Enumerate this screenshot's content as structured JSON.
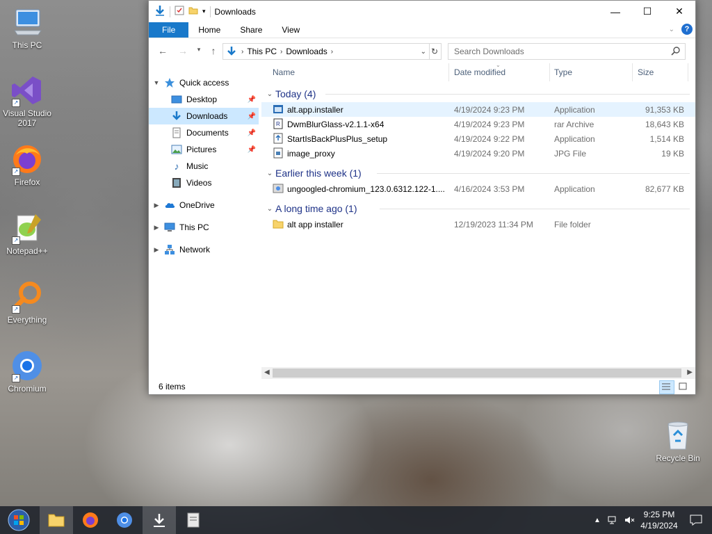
{
  "desktop": {
    "icons": [
      {
        "label": "This PC"
      },
      {
        "label": "Visual Studio 2017"
      },
      {
        "label": "Firefox"
      },
      {
        "label": "Notepad++"
      },
      {
        "label": "Everything"
      },
      {
        "label": "Chromium"
      },
      {
        "label": "Recycle Bin"
      }
    ]
  },
  "window": {
    "title": "Downloads",
    "ribbon_tabs": [
      "File",
      "Home",
      "Share",
      "View"
    ],
    "help": "?",
    "breadcrumb": [
      "This PC",
      "Downloads"
    ],
    "search_placeholder": "Search Downloads",
    "nav": {
      "quick_access": "Quick access",
      "items": [
        "Desktop",
        "Downloads",
        "Documents",
        "Pictures",
        "Music",
        "Videos"
      ],
      "onedrive": "OneDrive",
      "this_pc": "This PC",
      "network": "Network"
    },
    "columns": [
      "Name",
      "Date modified",
      "Type",
      "Size"
    ],
    "groups": [
      {
        "title": "Today (4)",
        "files": [
          {
            "name": "alt.app.installer",
            "date": "4/19/2024 9:23 PM",
            "type": "Application",
            "size": "91,353 KB"
          },
          {
            "name": "DwmBlurGlass-v2.1.1-x64",
            "date": "4/19/2024 9:23 PM",
            "type": "rar Archive",
            "size": "18,643 KB"
          },
          {
            "name": "StartIsBackPlusPlus_setup",
            "date": "4/19/2024 9:22 PM",
            "type": "Application",
            "size": "1,514 KB"
          },
          {
            "name": "image_proxy",
            "date": "4/19/2024 9:20 PM",
            "type": "JPG File",
            "size": "19 KB"
          }
        ]
      },
      {
        "title": "Earlier this week (1)",
        "files": [
          {
            "name": "ungoogled-chromium_123.0.6312.122-1....",
            "date": "4/16/2024 3:53 PM",
            "type": "Application",
            "size": "82,677 KB"
          }
        ]
      },
      {
        "title": "A long time ago (1)",
        "files": [
          {
            "name": "alt app installer",
            "date": "12/19/2023 11:34 PM",
            "type": "File folder",
            "size": ""
          }
        ]
      }
    ],
    "status": "6 items"
  },
  "taskbar": {
    "time": "9:25 PM",
    "date": "4/19/2024"
  },
  "colors": {
    "accent": "#1979ca",
    "selection": "#cce8ff",
    "group_title": "#1e3287"
  }
}
